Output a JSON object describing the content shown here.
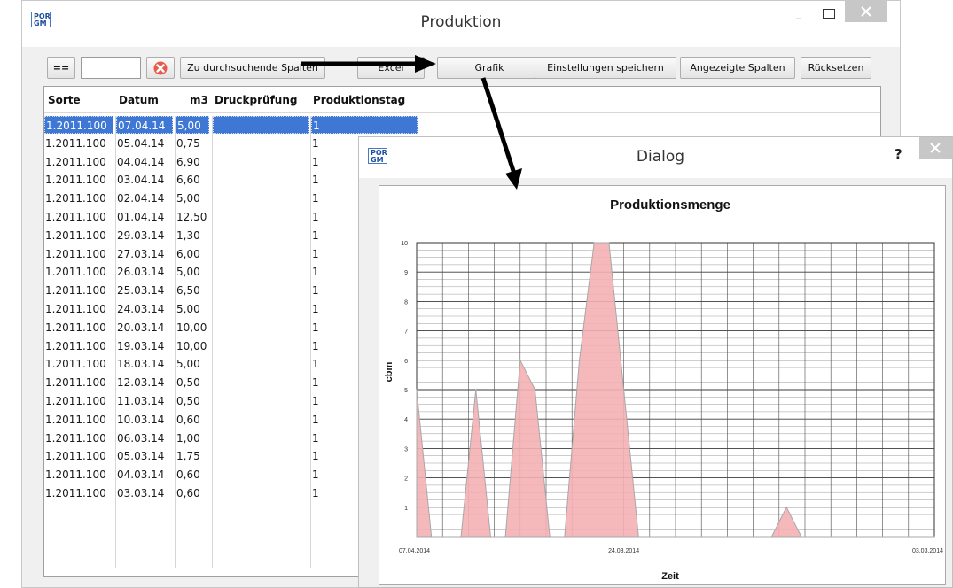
{
  "main_window": {
    "title": "Produktion",
    "minimize_label": "–"
  },
  "toolbar": {
    "equals_label": "==",
    "filter_value": "",
    "search_columns_label": "Zu durchsuchende Spalten",
    "excel_label": "Excel",
    "grafik_label": "Grafik",
    "save_settings_label": "Einstellungen speichern",
    "shown_columns_label": "Angezeigte Spalten",
    "reset_label": "Rücksetzen"
  },
  "table": {
    "columns": [
      "Sorte",
      "Datum",
      "m3",
      "Druckprüfung",
      "Produktionstag"
    ],
    "rows": [
      {
        "sorte": "1.2011.100",
        "datum": "07.04.14",
        "m3": "5,00",
        "druck": "",
        "prod": "1"
      },
      {
        "sorte": "1.2011.100",
        "datum": "05.04.14",
        "m3": "0,75",
        "druck": "",
        "prod": "1"
      },
      {
        "sorte": "1.2011.100",
        "datum": "04.04.14",
        "m3": "6,90",
        "druck": "",
        "prod": "1"
      },
      {
        "sorte": "1.2011.100",
        "datum": "03.04.14",
        "m3": "6,60",
        "druck": "",
        "prod": "1"
      },
      {
        "sorte": "1.2011.100",
        "datum": "02.04.14",
        "m3": "5,00",
        "druck": "",
        "prod": "1"
      },
      {
        "sorte": "1.2011.100",
        "datum": "01.04.14",
        "m3": "12,50",
        "druck": "",
        "prod": "1"
      },
      {
        "sorte": "1.2011.100",
        "datum": "29.03.14",
        "m3": "1,30",
        "druck": "",
        "prod": "1"
      },
      {
        "sorte": "1.2011.100",
        "datum": "27.03.14",
        "m3": "6,00",
        "druck": "",
        "prod": "1"
      },
      {
        "sorte": "1.2011.100",
        "datum": "26.03.14",
        "m3": "5,00",
        "druck": "",
        "prod": "1"
      },
      {
        "sorte": "1.2011.100",
        "datum": "25.03.14",
        "m3": "6,50",
        "druck": "",
        "prod": "1"
      },
      {
        "sorte": "1.2011.100",
        "datum": "24.03.14",
        "m3": "5,00",
        "druck": "",
        "prod": "1"
      },
      {
        "sorte": "1.2011.100",
        "datum": "20.03.14",
        "m3": "10,00",
        "druck": "",
        "prod": "1"
      },
      {
        "sorte": "1.2011.100",
        "datum": "19.03.14",
        "m3": "10,00",
        "druck": "",
        "prod": "1"
      },
      {
        "sorte": "1.2011.100",
        "datum": "18.03.14",
        "m3": "5,00",
        "druck": "",
        "prod": "1"
      },
      {
        "sorte": "1.2011.100",
        "datum": "12.03.14",
        "m3": "0,50",
        "druck": "",
        "prod": "1"
      },
      {
        "sorte": "1.2011.100",
        "datum": "11.03.14",
        "m3": "0,50",
        "druck": "",
        "prod": "1"
      },
      {
        "sorte": "1.2011.100",
        "datum": "10.03.14",
        "m3": "0,60",
        "druck": "",
        "prod": "1"
      },
      {
        "sorte": "1.2011.100",
        "datum": "06.03.14",
        "m3": "1,00",
        "druck": "",
        "prod": "1"
      },
      {
        "sorte": "1.2011.100",
        "datum": "05.03.14",
        "m3": "1,75",
        "druck": "",
        "prod": "1"
      },
      {
        "sorte": "1.2011.100",
        "datum": "04.03.14",
        "m3": "0,60",
        "druck": "",
        "prod": "1"
      },
      {
        "sorte": "1.2011.100",
        "datum": "03.03.14",
        "m3": "0,60",
        "druck": "",
        "prod": "1"
      }
    ]
  },
  "dialog": {
    "title": "Dialog",
    "help_label": "?"
  },
  "chart_data": {
    "type": "area",
    "title": "Produktionsmenge",
    "xlabel": "Zeit",
    "ylabel": "cbm",
    "ylim": [
      0,
      10
    ],
    "yticks": [
      1,
      2,
      3,
      4,
      5,
      6,
      7,
      8,
      9,
      10
    ],
    "xtick_labels": [
      "07.04.2014",
      "24.03.2014",
      "03.03.2014"
    ],
    "x_range_days": [
      0,
      35
    ],
    "x_days_ago_of_labels": [
      0,
      14,
      35
    ],
    "points": [
      {
        "x": 0,
        "y": 5
      },
      {
        "x": 1,
        "y": 0
      },
      {
        "x": 3,
        "y": 0
      },
      {
        "x": 4,
        "y": 5
      },
      {
        "x": 5,
        "y": 0
      },
      {
        "x": 6,
        "y": 0
      },
      {
        "x": 7,
        "y": 6
      },
      {
        "x": 8,
        "y": 5
      },
      {
        "x": 9,
        "y": 0
      },
      {
        "x": 10,
        "y": 0
      },
      {
        "x": 11,
        "y": 6
      },
      {
        "x": 12,
        "y": 10
      },
      {
        "x": 13,
        "y": 10
      },
      {
        "x": 14,
        "y": 5
      },
      {
        "x": 15,
        "y": 0
      },
      {
        "x": 24,
        "y": 0
      },
      {
        "x": 25,
        "y": 1
      },
      {
        "x": 26,
        "y": 0
      },
      {
        "x": 35,
        "y": 0
      }
    ],
    "fill_color": "#f4b0b4",
    "stroke_color": "#a8a8a8",
    "grid": true
  }
}
